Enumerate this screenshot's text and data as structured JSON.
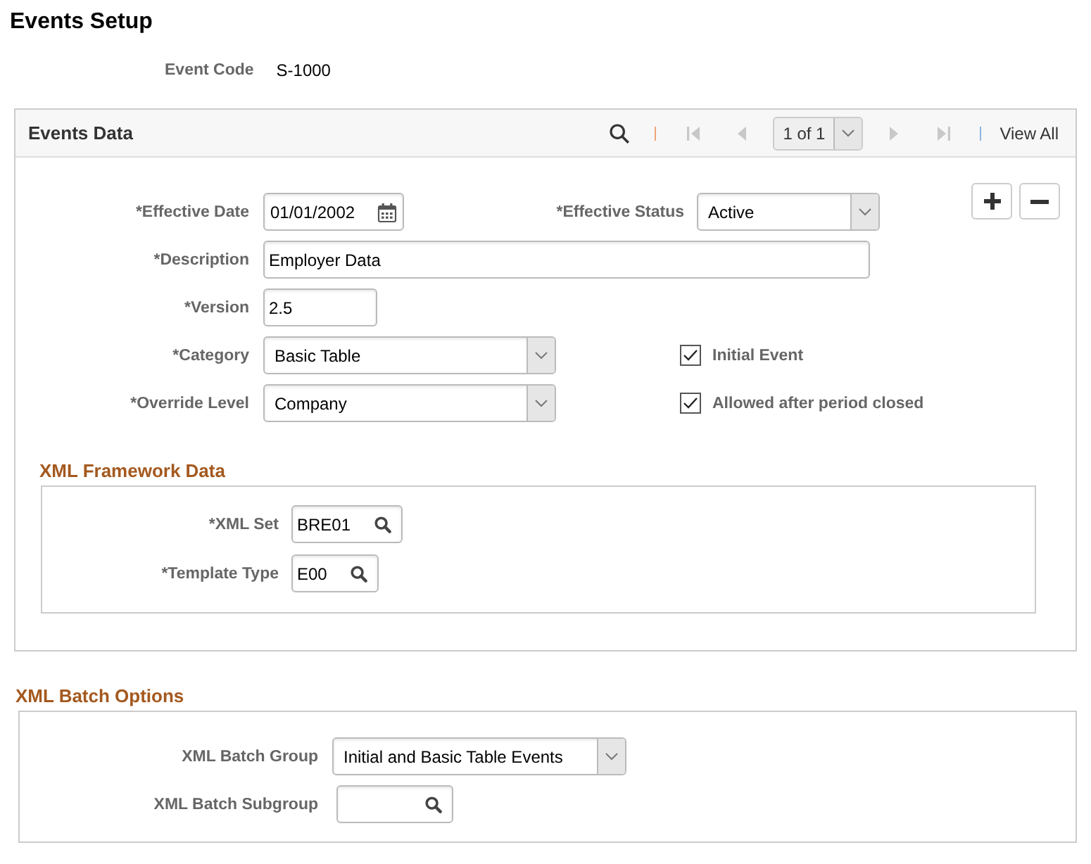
{
  "page": {
    "title": "Events Setup"
  },
  "event_code": {
    "label": "Event Code",
    "value": "S-1000"
  },
  "events_data": {
    "title": "Events Data",
    "toolbar": {
      "navigation": [
        {
          "kind": "first",
          "disabled": true
        },
        {
          "kind": "previous",
          "disabled": true
        },
        {
          "kind": "next",
          "disabled": true
        },
        {
          "kind": "last",
          "disabled": true
        }
      ],
      "page_indicator": "1 of 1",
      "view_all": "View All"
    },
    "rows": [
      {
        "field": {
          "kind": "date",
          "label": "*Effective Date",
          "value": "01/01/2002"
        },
        "side": {
          "kind": "select",
          "label": "*Effective Status",
          "value": "Active"
        }
      },
      {
        "field": {
          "kind": "long_text",
          "label": "*Description",
          "value": "Employer Data"
        }
      },
      {
        "field": {
          "kind": "short_text",
          "label": "*Version",
          "value": "2.5"
        }
      },
      {
        "field": {
          "kind": "select",
          "label": "*Category",
          "value": "Basic Table"
        },
        "side": {
          "kind": "checkbox",
          "label": "Initial Event",
          "checked": true
        }
      },
      {
        "field": {
          "kind": "select",
          "label": "*Override Level",
          "value": "Company"
        },
        "side": {
          "kind": "checkbox",
          "label": "Allowed after period closed",
          "checked": true
        }
      }
    ],
    "xml_framework": {
      "title": "XML Framework Data",
      "fields": [
        {
          "kind": "lookup",
          "label": "*XML Set",
          "value": "BRE01"
        },
        {
          "kind": "lookup",
          "label": "*Template Type",
          "value": "E00"
        }
      ]
    }
  },
  "xml_batch_options": {
    "title": "XML Batch Options",
    "fields": [
      {
        "kind": "select",
        "label": "XML Batch Group",
        "value": "Initial and Basic Table Events"
      },
      {
        "kind": "lookup",
        "label": "XML Batch Subgroup"
      }
    ]
  }
}
